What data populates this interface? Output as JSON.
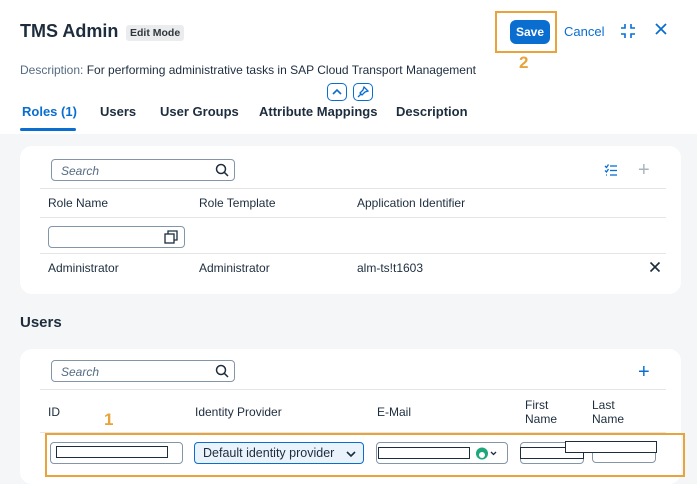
{
  "header": {
    "title": "TMS Admin",
    "mode_badge": "Edit Mode",
    "save_label": "Save",
    "cancel_label": "Cancel",
    "description_label": "Description:",
    "description_text": "For performing administrative tasks in SAP Cloud Transport Management"
  },
  "callouts": {
    "save": "2",
    "row": "1"
  },
  "tabs": [
    {
      "label": "Roles (1)",
      "active": true
    },
    {
      "label": "Users",
      "active": false
    },
    {
      "label": "User Groups",
      "active": false
    },
    {
      "label": "Attribute Mappings",
      "active": false
    },
    {
      "label": "Description",
      "active": false
    }
  ],
  "roles": {
    "search_placeholder": "Search",
    "columns": [
      "Role Name",
      "Role Template",
      "Application Identifier"
    ],
    "rows": [
      {
        "role_name": "Administrator",
        "role_template": "Administrator",
        "app_id": "alm-ts!t1603"
      }
    ]
  },
  "users": {
    "section_title": "Users",
    "search_placeholder": "Search",
    "columns": [
      "ID",
      "Identity Provider",
      "E-Mail",
      "First\nName",
      "Last\nName"
    ],
    "row": {
      "identity_provider": "Default identity provider"
    }
  },
  "icons": {
    "search": "search-icon",
    "fullscreen": "exit-fullscreen-icon",
    "close": "close-icon",
    "collapse": "chevron-up-icon",
    "pin": "pin-icon",
    "settings": "table-settings-icon",
    "add": "add-icon",
    "value_help": "value-help-icon",
    "dropdown": "chevron-down-icon"
  },
  "colors": {
    "accent": "#0a6ed1",
    "highlight": "#e8a33a",
    "text": "#1d2d3e"
  }
}
